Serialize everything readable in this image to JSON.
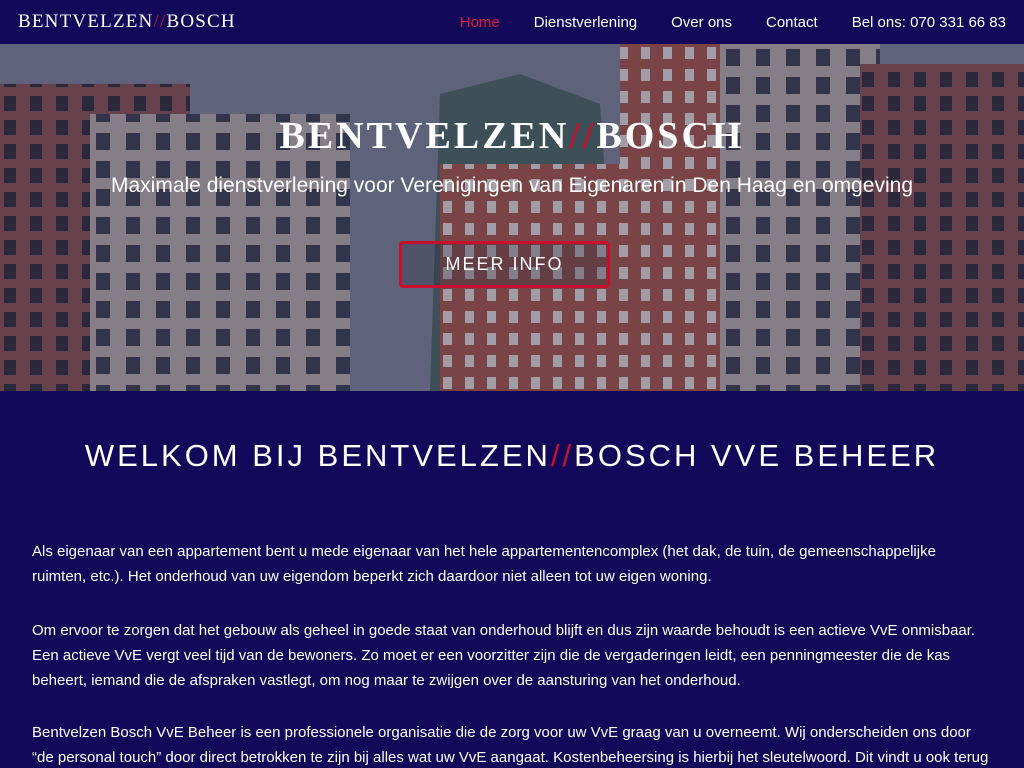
{
  "nav": {
    "logo_part1": "BENTVELZEN",
    "logo_slash": "//",
    "logo_part2": "BOSCH",
    "links": [
      {
        "label": "Home"
      },
      {
        "label": "Dienstverlening"
      },
      {
        "label": "Over ons"
      },
      {
        "label": "Contact"
      },
      {
        "label": "Bel ons: 070 331 66 83"
      }
    ]
  },
  "hero": {
    "title_part1": "BENTVELZEN",
    "title_slash": "//",
    "title_part2": "BOSCH",
    "subtitle": "Maximale dienstverlening voor Verenigingen van Eigenaren in Den Haag en omgeving",
    "button_label": "MEER INFO"
  },
  "main": {
    "heading_part1": "WELKOM BIJ BENTVELZEN",
    "heading_slash": "//",
    "heading_part2": "BOSCH VVE BEHEER",
    "paragraphs": [
      "Als eigenaar van een appartement bent u mede eigenaar van het hele appartementencomplex (het dak, de tuin, de gemeenschappelijke ruimten, etc.). Het onderhoud van uw eigendom beperkt zich daardoor niet alleen tot uw eigen woning.",
      "Om ervoor te zorgen dat het gebouw als geheel in goede staat van onderhoud blijft en dus zijn waarde behoudt is een actieve VvE onmisbaar. Een actieve VvE vergt veel tijd van de bewoners. Zo moet er een voorzitter zijn die de vergaderingen leidt, een penningmeester die de kas beheert, iemand die de afspraken vastlegt, om nog maar te zwijgen over de aansturing van het onderhoud.",
      "Bentvelzen Bosch VvE Beheer is een professionele organisatie die de zorg voor uw VvE graag van u overneemt. Wij onderscheiden ons door “de personal touch” door direct betrokken te zijn bij alles wat uw VvE aangaat. Kostenbeheersing is hierbij het sleutelwoord. Dit vindt u ook terug in"
    ]
  },
  "colors": {
    "navy": "#12085a",
    "accent_red": "#c8102e",
    "active_link": "#d81b36"
  }
}
